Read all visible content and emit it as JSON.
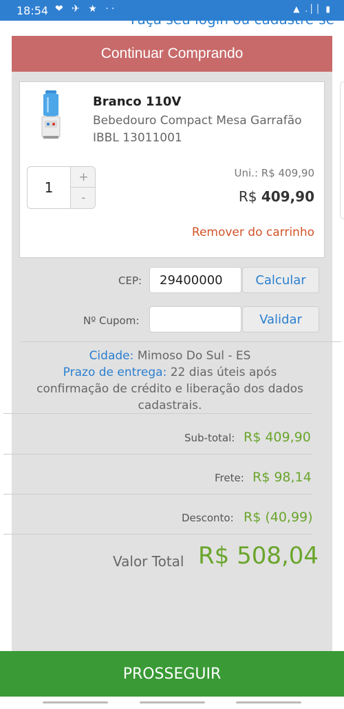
{
  "status_bar": {
    "time": "18:54",
    "notification_icons": "❤ ✈ ★ ··",
    "system_icons": "▲ .││ ▮"
  },
  "header": {
    "login_link": "Faça seu login ou cadastre-se"
  },
  "continue_button": "Continuar Comprando",
  "cart_item": {
    "variant": "Branco 110V",
    "name": "Bebedouro Compact Mesa Garrafão IBBL 13011001",
    "quantity": "1",
    "plus": "+",
    "minus": "-",
    "unit_price": "Uni.: R$ 409,90",
    "price_currency": "R$",
    "price_value": "409,90",
    "remove": "Remover do carrinho"
  },
  "shipping": {
    "cep_label": "CEP:",
    "cep_value": "29400000",
    "calc_button": "Calcular",
    "coupon_label": "Nº Cupom:",
    "coupon_value": "",
    "validate_button": "Validar"
  },
  "delivery": {
    "city_label": "Cidade:",
    "city_value": "Mimoso Do Sul - ES",
    "term_label": "Prazo de entrega:",
    "term_value": "22 dias úteis após confirmação de crédito e liberação dos dados cadastrais."
  },
  "summary": {
    "subtotal_label": "Sub-total:",
    "subtotal_value": "R$ 409,90",
    "freight_label": "Frete:",
    "freight_value": "R$ 98,14",
    "discount_label": "Desconto:",
    "discount_value": "R$ (40,99)",
    "total_label": "Valor Total",
    "total_value": "R$ 508,04"
  },
  "proceed_button": "PROSSEGUIR",
  "colors": {
    "continue_bg": "#c8696a",
    "proceed_bg": "#3a9a36",
    "link_blue": "#2a7fd0",
    "price_green": "#6aa52c",
    "remove_red": "#d2532a"
  }
}
